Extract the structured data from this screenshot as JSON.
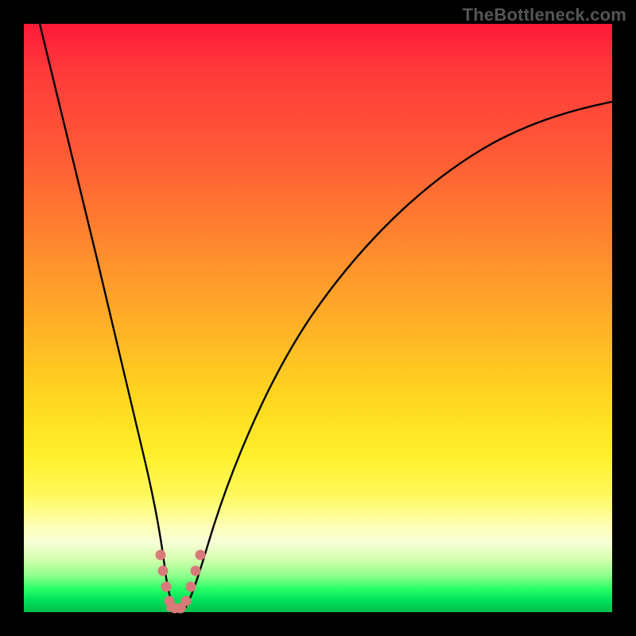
{
  "watermark": "TheBottleneck.com",
  "colors": {
    "frame": "#000000",
    "curve": "#000000",
    "marker": "#d97a7a",
    "gradient_top": "#ff1a3a",
    "gradient_bottom": "#00c04a"
  },
  "chart_data": {
    "type": "line",
    "title": "",
    "xlabel": "",
    "ylabel": "",
    "xlim": [
      0,
      100
    ],
    "ylim": [
      0,
      100
    ],
    "grid": false,
    "legend": false,
    "annotations": [
      "TheBottleneck.com"
    ],
    "x": [
      0,
      2,
      4,
      6,
      8,
      10,
      12,
      14,
      16,
      18,
      20,
      21,
      22,
      23,
      24,
      25,
      26,
      27,
      28,
      30,
      32,
      35,
      40,
      45,
      50,
      55,
      60,
      65,
      70,
      75,
      80,
      85,
      90,
      95,
      100
    ],
    "y": [
      100,
      92,
      84,
      76,
      68,
      60,
      52,
      44,
      36,
      27,
      17,
      12,
      7,
      3,
      0.5,
      0,
      0.5,
      3,
      8,
      18,
      27,
      37,
      49,
      57,
      64,
      69,
      73,
      76,
      79,
      81,
      82.5,
      84,
      85,
      85.8,
      86.5
    ],
    "markers": {
      "x": [
        21.5,
        22.3,
        23.0,
        24.0,
        25.2,
        26.0,
        27.0,
        27.6,
        28.3
      ],
      "y": [
        10,
        7,
        4,
        1,
        0.5,
        1,
        4,
        7,
        10
      ]
    },
    "bottom_flat_segment": {
      "x_start": 23.5,
      "x_end": 26.5,
      "y": 0
    }
  }
}
